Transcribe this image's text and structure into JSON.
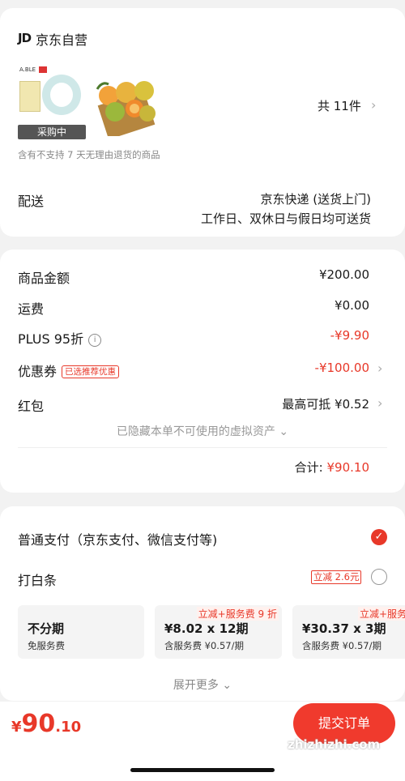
{
  "store": {
    "logo": "JD",
    "name": "京东自营"
  },
  "items": {
    "thumb1_logo": "A.BLE",
    "badge": "采购中",
    "count": "共 11件",
    "no_return_note": "含有不支持 7 天无理由退货的商品"
  },
  "delivery": {
    "label": "配送",
    "method": "京东快递 (送货上门)",
    "schedule": "工作日、双休日与假日均可送货"
  },
  "summary": {
    "goods_label": "商品金额",
    "goods_value": "¥200.00",
    "shipping_label": "运费",
    "shipping_value": "¥0.00",
    "plus_label": "PLUS 95折",
    "plus_info_icon": "i",
    "plus_value": "-¥9.90",
    "coupon_label": "优惠券",
    "coupon_tag": "已选推荐优惠",
    "coupon_value": "-¥100.00",
    "redpacket_label": "红包",
    "redpacket_value": "最高可抵 ¥0.52",
    "hidden_assets": "已隐藏本单不可使用的虚拟资产 ⌄",
    "total_label": "合计: ",
    "total_value": "¥90.10"
  },
  "payment": {
    "normal_label": "普通支付（京东支付、微信支付等)",
    "baitiao_label": "打白条",
    "baitiao_promo": "立减 2.6元",
    "plans": [
      {
        "tag": "",
        "main": "不分期",
        "sub": "免服务费"
      },
      {
        "tag": "立减+服务费 9 折",
        "main": "¥8.02 x 12期",
        "sub": "含服务费 ¥0.57/期"
      },
      {
        "tag": "立减+服务",
        "main": "¥30.37 x 3期",
        "sub": "含服务费 ¥0.57/期"
      }
    ],
    "expand_more": "展开更多 ⌄"
  },
  "bottom": {
    "currency": "¥",
    "price_int": "90",
    "price_dec": ".10",
    "submit_label": "提交订单",
    "watermark": "zhizhizhi.com"
  },
  "colors": {
    "accent": "#e83829",
    "background": "#f2f2f2"
  }
}
